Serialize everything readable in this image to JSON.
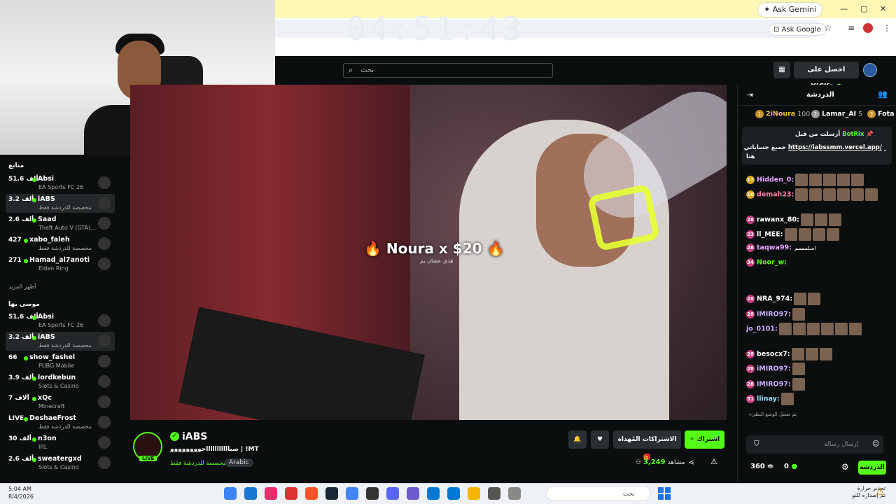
{
  "browser": {
    "ask_gemini": "Ask Gemini",
    "ask_google": "Ask Google",
    "overlay_clock": "04:51:43"
  },
  "header": {
    "search_placeholder": "بحث",
    "get_kicks": "احصل على KICKs"
  },
  "sidebar": {
    "following_title": "متابع",
    "show_more": "أظهر المزيد",
    "recommended_title": "موصى بها",
    "following": [
      {
        "name": "Absi",
        "count": "51.6 ألف",
        "sub": "EA Sports FC 26",
        "sel": false
      },
      {
        "name": "iABS",
        "count": "3.2 ألف",
        "sub": "مخصصة للدردشة فقط",
        "sel": true
      },
      {
        "name": "Saad",
        "count": "2.6 ألف",
        "sub": "Theft Auto V (GTA)...",
        "sel": false
      },
      {
        "name": "xabo_faleh",
        "count": "427",
        "sub": "مخصصة للدردشة فقط",
        "sel": false
      },
      {
        "name": "Hamad_al7anoti",
        "count": "271",
        "sub": "Elden Ring",
        "sel": false
      }
    ],
    "recommended": [
      {
        "name": "Absi",
        "count": "51.6 ألف",
        "sub": "EA Sports FC 26",
        "sel": false
      },
      {
        "name": "iABS",
        "count": "3.2 ألف",
        "sub": "مخصصة للدردشة فقط",
        "sel": true
      },
      {
        "name": "show_fashel",
        "count": "66",
        "sub": "PUBG Mobile",
        "sel": false
      },
      {
        "name": "lordkebun",
        "count": "3.9 ألف",
        "sub": "Slots & Casino",
        "sel": false
      },
      {
        "name": "xQc",
        "count": "7 آلاف",
        "sub": "Minecraft",
        "sel": false
      },
      {
        "name": "DeshaeFrost",
        "count": "LIVE",
        "sub": "مخصصة للدردشة فقط",
        "sel": false
      },
      {
        "name": "n3on",
        "count": "30 ألف",
        "sub": "IRL",
        "sel": false
      },
      {
        "name": "sweatergxd",
        "count": "2.6 ألف",
        "sub": "Slots & Casino",
        "sel": false
      }
    ]
  },
  "video": {
    "overlay_title": "Noura x $20",
    "overlay_sub": "هذي عشان يم"
  },
  "stream": {
    "name": "iABS",
    "live": "LIVE",
    "title": "صباااااااااااحوووووووو | !MT",
    "category": "مخصصة للدردشة فقط",
    "tag": "Arabic",
    "viewers_count": "3,249",
    "viewers_label": "مشاهد",
    "subscribe": "اشتراك",
    "gifted": "الاشتراكات المُهداة"
  },
  "chat": {
    "title": "الدردشة",
    "leaderboard": [
      {
        "name": "2iNoura",
        "value": "100"
      },
      {
        "name": "Lamar_AI",
        "value": "5"
      },
      {
        "name": "Fota",
        "value": ""
      }
    ],
    "pinned_sender": "BotRix",
    "pinned_by": "أرسلت من قبل",
    "pinned_link": "https://iabssmm.vercel.app/",
    "pinned_text": "جميع حساباتي",
    "pinned_more": "هنا",
    "messages": [
      {
        "badge": "17",
        "user": "Hidden_0:",
        "emotes": 5
      },
      {
        "badge": "10",
        "user": "demah23:",
        "emotes": 6
      },
      {
        "badge": "28",
        "user": "rawanx_80:",
        "emotes": 3
      },
      {
        "badge": "23",
        "user": "ll_MEE:",
        "emotes": 4
      },
      {
        "badge": "28",
        "user": "taqwa99:",
        "text": "اسلمممم"
      },
      {
        "badge": "34",
        "user": "Noor_w:",
        "text": ""
      },
      {
        "badge": "28",
        "user": "NRA_974:",
        "emotes": 2
      },
      {
        "badge": "28",
        "user": "iMIRO97:",
        "emotes": 1
      },
      {
        "badge": "",
        "user": "jo_0101:",
        "emotes": 6
      },
      {
        "badge": "28",
        "user": "besocx7:",
        "emotes": 3
      },
      {
        "badge": "28",
        "user": "iMIRO97:",
        "emotes": 1
      },
      {
        "badge": "28",
        "user": "iMIRO97:",
        "emotes": 1
      },
      {
        "badge": "31",
        "user": "llinay:",
        "emotes": 1
      }
    ],
    "slow_mode": "تم تفعيل الوضع البطيء",
    "input_placeholder": "إرسال رسالة",
    "send": "الدردشة",
    "points": "360",
    "kicks": "0"
  },
  "taskbar": {
    "time": "5:04 AM",
    "date": "8/4/2026",
    "search": "بحث",
    "weather_title": "تحذير حرارة",
    "weather_sub": "تم إصداره للتو"
  },
  "colors": {
    "accent": "#53fc18",
    "bg": "#0b0e0f"
  }
}
